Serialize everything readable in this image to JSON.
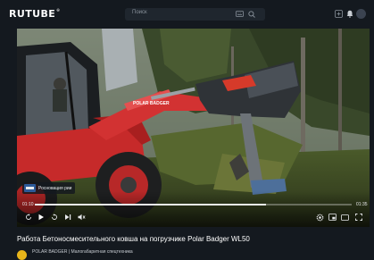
{
  "header": {
    "logo": "RUTUBE",
    "logo_mark": "®",
    "search_placeholder": "Поиск"
  },
  "player": {
    "channel_badge": "Росновация рии",
    "time_current": "01:10",
    "time_total": "01:35",
    "progress": 0.73
  },
  "video": {
    "title": "Работа Бетоносмесительного ковша на погрузчике Polar Badger WL50",
    "channel_line": "POLAR BADGER | Малогабаритная спецтехника"
  }
}
